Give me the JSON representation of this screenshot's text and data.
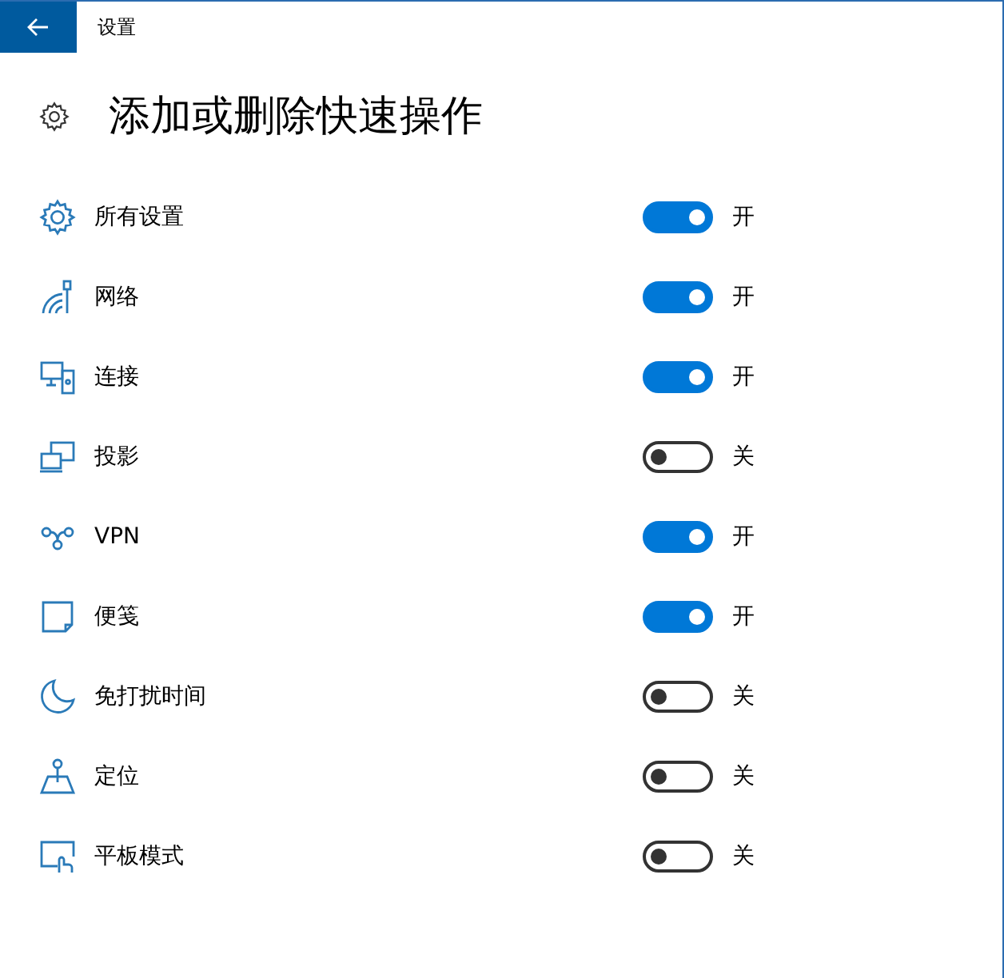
{
  "window": {
    "title": "设置"
  },
  "page": {
    "title": "添加或删除快速操作"
  },
  "actions": [
    {
      "kind": "settings",
      "label": "所有设置",
      "on": true,
      "state": "开"
    },
    {
      "kind": "network",
      "label": "网络",
      "on": true,
      "state": "开"
    },
    {
      "kind": "connect",
      "label": "连接",
      "on": true,
      "state": "开"
    },
    {
      "kind": "project",
      "label": "投影",
      "on": false,
      "state": "关"
    },
    {
      "kind": "vpn",
      "label": "VPN",
      "on": true,
      "state": "开"
    },
    {
      "kind": "note",
      "label": "便笺",
      "on": true,
      "state": "开"
    },
    {
      "kind": "quiet",
      "label": "免打扰时间",
      "on": false,
      "state": "关"
    },
    {
      "kind": "location",
      "label": "定位",
      "on": false,
      "state": "关"
    },
    {
      "kind": "tablet",
      "label": "平板模式",
      "on": false,
      "state": "关"
    }
  ]
}
